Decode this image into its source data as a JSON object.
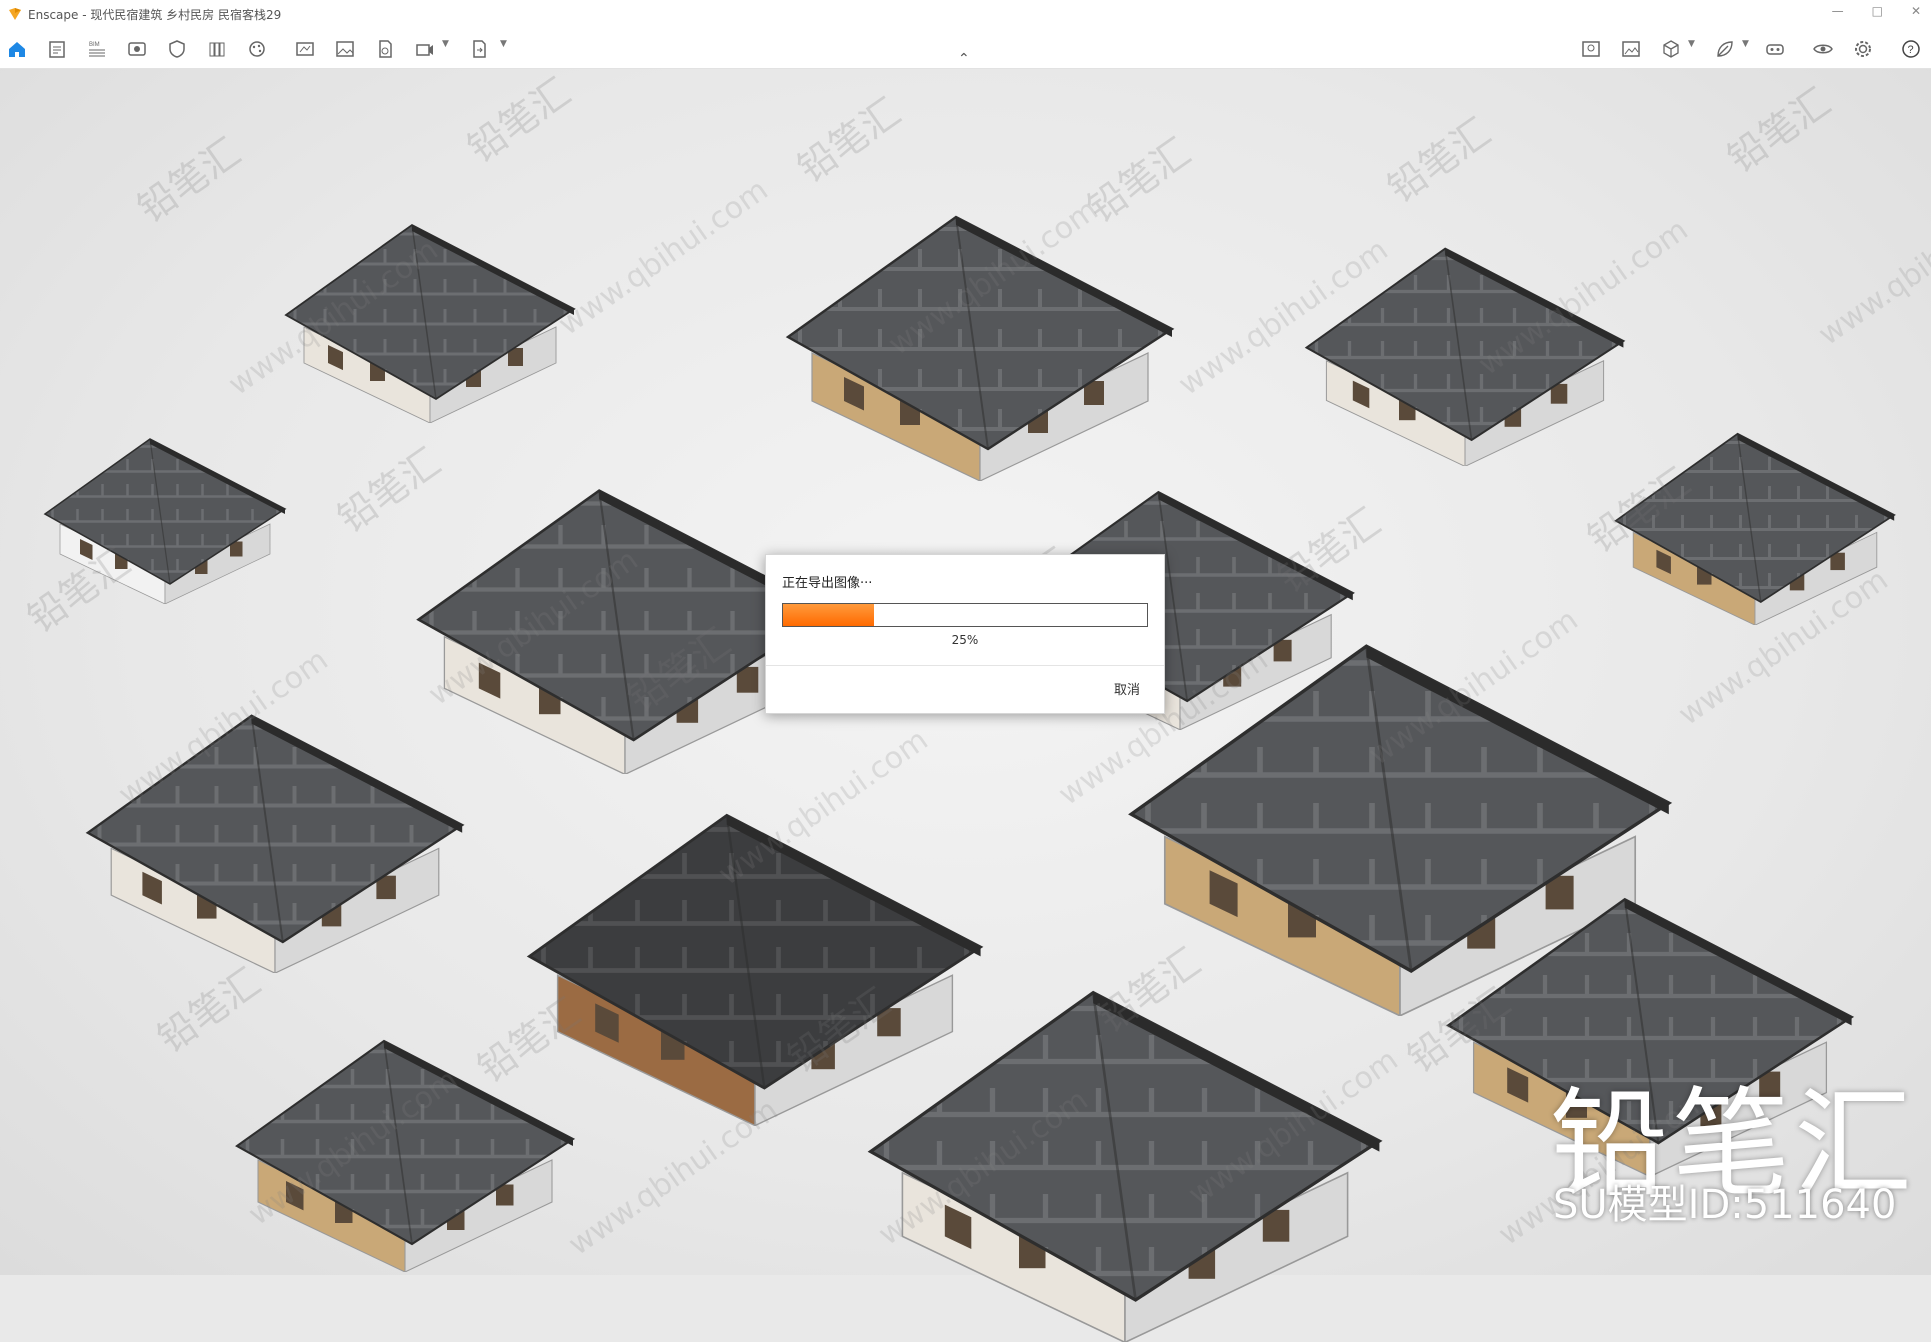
{
  "window": {
    "title": "Enscape - 现代民宿建筑 乡村民房 民宿客栈29",
    "controls": [
      "—",
      "□",
      "✕"
    ]
  },
  "toolbar": {
    "left_icons": [
      "home-icon",
      "notes-icon",
      "bim-icon",
      "view-icon",
      "shield-icon",
      "library-icon",
      "palette-icon",
      "render-icon",
      "image-icon",
      "clock-icon",
      "video-icon",
      "export-icon"
    ],
    "right_icons": [
      "map-icon",
      "screenshot-icon",
      "cube-icon",
      "leaf-icon",
      "vr-icon",
      "eye-icon",
      "settings-icon",
      "help-icon"
    ],
    "accent": "#1e88e5"
  },
  "dialog": {
    "title": "正在导出图像···",
    "progress_label": "25%",
    "progress": 0.25,
    "cancel_label": "取消",
    "progress_color": "#ff7a1a"
  },
  "watermark": {
    "brand": "铅笔汇",
    "model_id": "SU模型ID:511640",
    "text": "铅笔汇",
    "url": "www.qbihui.com"
  }
}
